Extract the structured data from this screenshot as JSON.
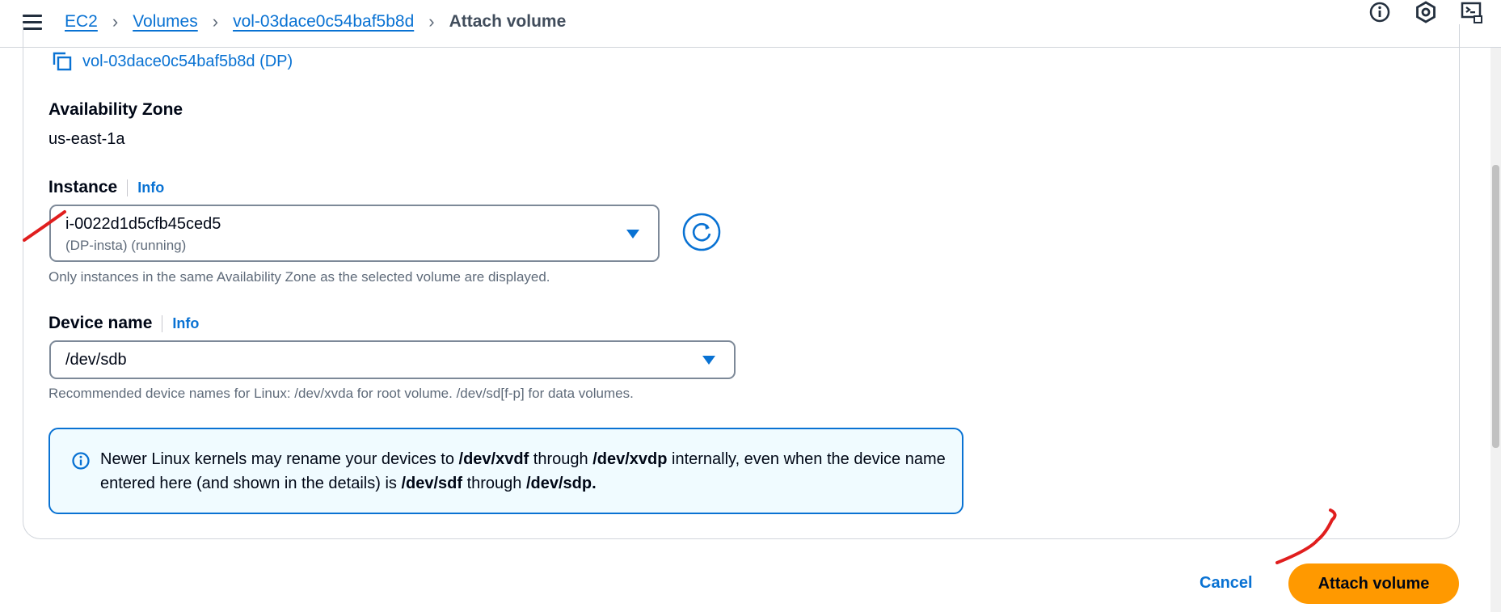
{
  "breadcrumb": {
    "items": [
      "EC2",
      "Volumes",
      "vol-03dace0c54baf5b8d"
    ],
    "current": "Attach volume"
  },
  "volume": {
    "link_text": "vol-03dace0c54baf5b8d (DP)"
  },
  "availability_zone": {
    "label": "Availability Zone",
    "value": "us-east-1a"
  },
  "instance": {
    "label": "Instance",
    "info": "Info",
    "selected_id": "i-0022d1d5cfb45ced5",
    "selected_desc": "(DP-insta) (running)",
    "hint": "Only instances in the same Availability Zone as the selected volume are displayed."
  },
  "device": {
    "label": "Device name",
    "info": "Info",
    "selected": "/dev/sdb",
    "hint": "Recommended device names for Linux: /dev/xvda for root volume. /dev/sd[f-p] for data volumes."
  },
  "alert": {
    "t1": "Newer Linux kernels may rename your devices to ",
    "b1": "/dev/xvdf",
    "t2": " through ",
    "b2": "/dev/xvdp",
    "t3": " internally, even when the device name entered here (and shown in the details) is ",
    "b3": "/dev/sdf",
    "t4": " through ",
    "b4": "/dev/sdp."
  },
  "actions": {
    "cancel": "Cancel",
    "attach": "Attach volume"
  },
  "colors": {
    "link": "#0972d3",
    "primary_button": "#ff9900",
    "alert_bg": "#f0fbff",
    "annotation": "#e01e1e"
  },
  "icons": [
    "menu-icon",
    "info-circle-icon",
    "settings-hex-icon",
    "cloudshell-icon",
    "copy-icon",
    "refresh-icon",
    "dropdown-caret-icon"
  ]
}
